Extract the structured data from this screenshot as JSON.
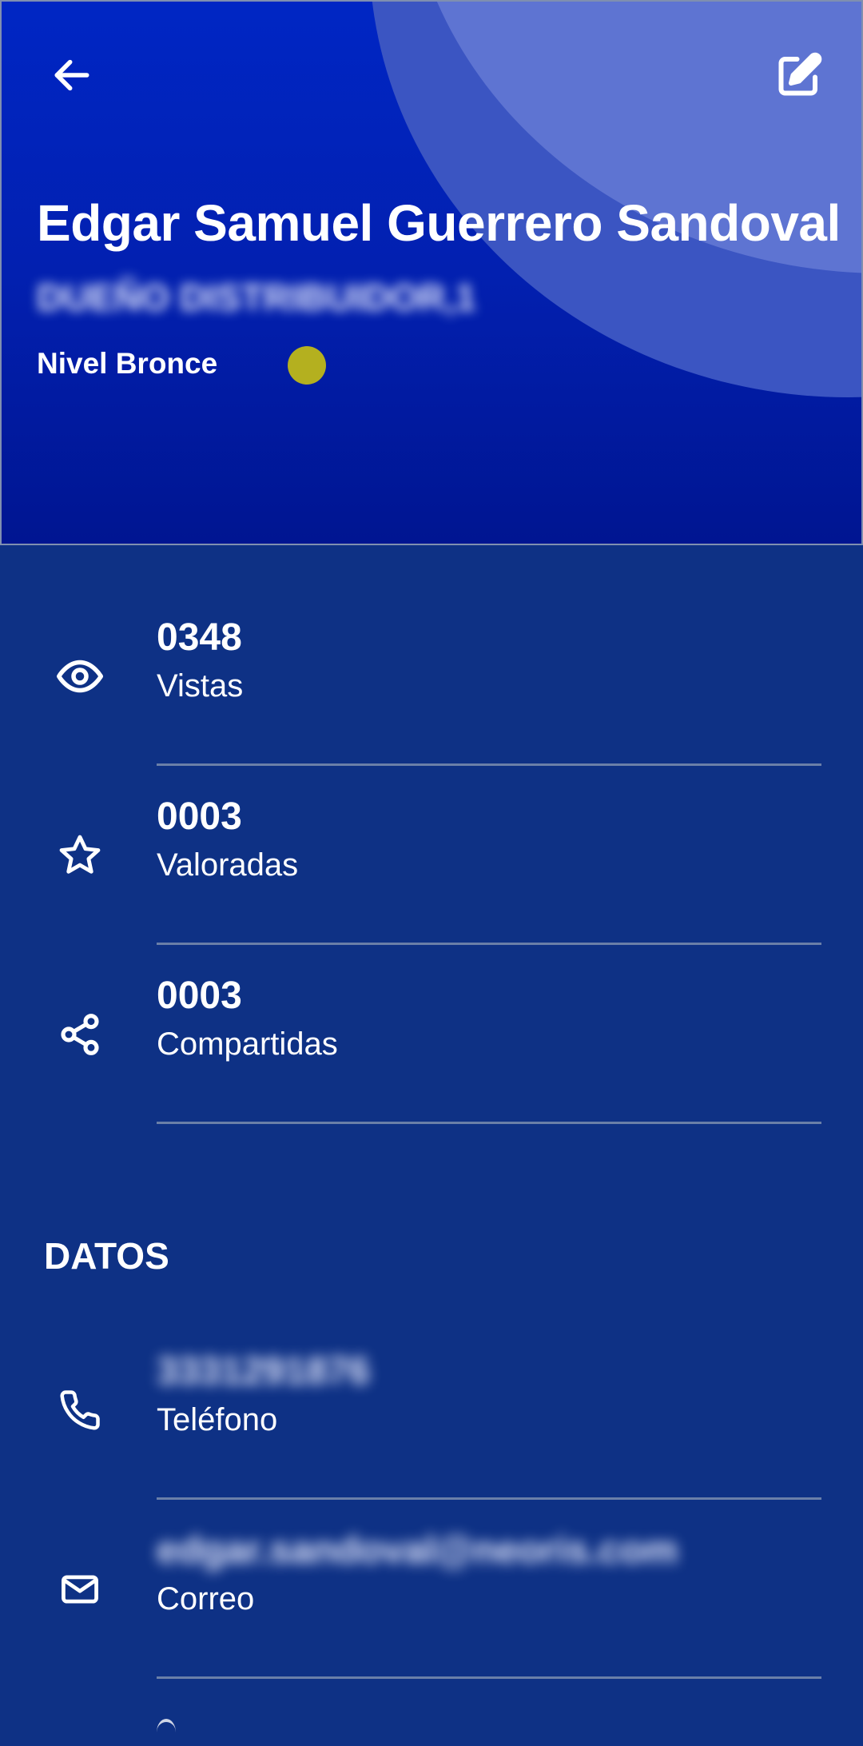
{
  "profile": {
    "name": "Edgar Samuel Guerrero Sandoval",
    "role": "DUEÑO DISTRIBUIDOR,1",
    "level": "Nivel Bronce",
    "level_color": "#b4b01f"
  },
  "header": {
    "back_icon": "arrow-left-icon",
    "edit_icon": "edit-icon"
  },
  "stats": [
    {
      "icon": "eye-icon",
      "value": "0348",
      "label": "Vistas"
    },
    {
      "icon": "star-icon",
      "value": "0003",
      "label": "Valoradas"
    },
    {
      "icon": "share-icon",
      "value": "0003",
      "label": "Compartidas"
    }
  ],
  "datos": {
    "title": "DATOS",
    "items": [
      {
        "icon": "phone-icon",
        "value": "3331291876",
        "label": "Teléfono"
      },
      {
        "icon": "mail-icon",
        "value": "edgar.sandoval@neoris.com",
        "label": "Correo"
      }
    ]
  },
  "colors": {
    "header_top": "#0026c4",
    "header_bottom": "#001591",
    "body_bg": "#0e3185",
    "divider": "#6a7fa8"
  }
}
